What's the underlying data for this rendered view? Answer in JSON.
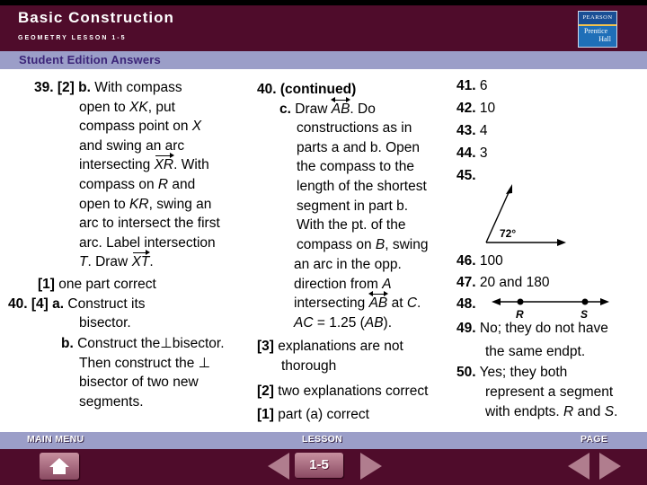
{
  "header": {
    "title": "Basic Construction",
    "subtitle": "GEOMETRY LESSON 1-5",
    "logo_top": "PEARSON",
    "logo_line1": "Prentice",
    "logo_line2": "Hall"
  },
  "band": {
    "label": "Student Edition Answers"
  },
  "col1": {
    "q39_num": "39.",
    "q39_score": "[2]",
    "q39_part": "b.",
    "q39_l1": "With compass",
    "q39_l2a": "open to ",
    "q39_l2v": "XK",
    "q39_l2b": ", put",
    "q39_l3a": "compass point on ",
    "q39_l3v": "X",
    "q39_l4": "and swing an arc",
    "q39_l5a": "intersecting ",
    "q39_l5v": "XR",
    "q39_l5b": ". With",
    "q39_l6a": "compass on ",
    "q39_l6v": "R",
    "q39_l6b": " and",
    "q39_l7a": "open to  ",
    "q39_l7v": "KR",
    "q39_l7b": ", swing an",
    "q39_l8": "arc to intersect the first",
    "q39_l9": "arc. Label intersection",
    "q39_l10v": "T",
    "q39_l10a": ". Draw ",
    "q39_l10v2": "XT",
    "q39_l10b": ".",
    "q39_s1_score": "[1]",
    "q39_s1_text": " one part correct",
    "q40_num": "40.",
    "q40_score": "[4]",
    "q40_a": "a.",
    "q40_a1": " Construct its",
    "q40_a2": "bisector.",
    "q40_b": "b.",
    "q40_b1": " Construct the⊥bisector.",
    "q40_b2": "Then construct the ⊥",
    "q40_b3": "bisector of two new",
    "q40_b4": "segments."
  },
  "col2": {
    "head": "40. (continued)",
    "c": "c.",
    "c1a": " Draw ",
    "c1v": "AB",
    "c1b": ". Do",
    "c2": "constructions as in",
    "c3": "parts a and b. Open",
    "c4": "the compass to the",
    "c5": "length of the shortest",
    "c6": "segment in part b.",
    "c7": "With the pt. of the",
    "c8a": "compass on ",
    "c8v": "B",
    "c8b": ", swing",
    "c9": "an arc in the opp.",
    "c10a": "direction from ",
    "c10v": "A",
    "c11a": "intersecting ",
    "c11v": "AB",
    "c11b": " at ",
    "c11v2": "C",
    "c11c": ".",
    "c12v": "AC",
    "c12a": " = 1.25 (",
    "c12v2": "AB",
    "c12b": ").",
    "s3_score": "[3]",
    "s3_l1": " explanations are not",
    "s3_l2": "thorough",
    "s2_score": "[2]",
    "s2_text": " two explanations correct",
    "s1_score": "[1]",
    "s1_text": " part (a) correct"
  },
  "col3": {
    "q41_num": "41.",
    "q41_ans": "6",
    "q42_num": "42.",
    "q42_ans": "10",
    "q43_num": "43.",
    "q43_ans": "4",
    "q44_num": "44.",
    "q44_ans": "3",
    "q45_num": "45.",
    "q45_angle": "72°",
    "q46_num": "46.",
    "q46_ans": "100",
    "q47_num": "47.",
    "q47_ans": "20 and 180",
    "q48_num": "48.",
    "q48_p1": "R",
    "q48_p2": "S",
    "q49_num": "49.",
    "q49_l1": "No; they do not have",
    "q49_l2": "the same endpt.",
    "q50_num": "50.",
    "q50_l1": "Yes; they both",
    "q50_l2": "represent a segment",
    "q50_l3a": "with endpts. ",
    "q50_l3v": "R",
    "q50_l3b": " and ",
    "q50_l3v2": "S",
    "q50_l3c": "."
  },
  "nav": {
    "main_menu_label": "MAIN MENU",
    "lesson_label": "LESSON",
    "lesson_value": "1-5",
    "page_label": "PAGE"
  }
}
